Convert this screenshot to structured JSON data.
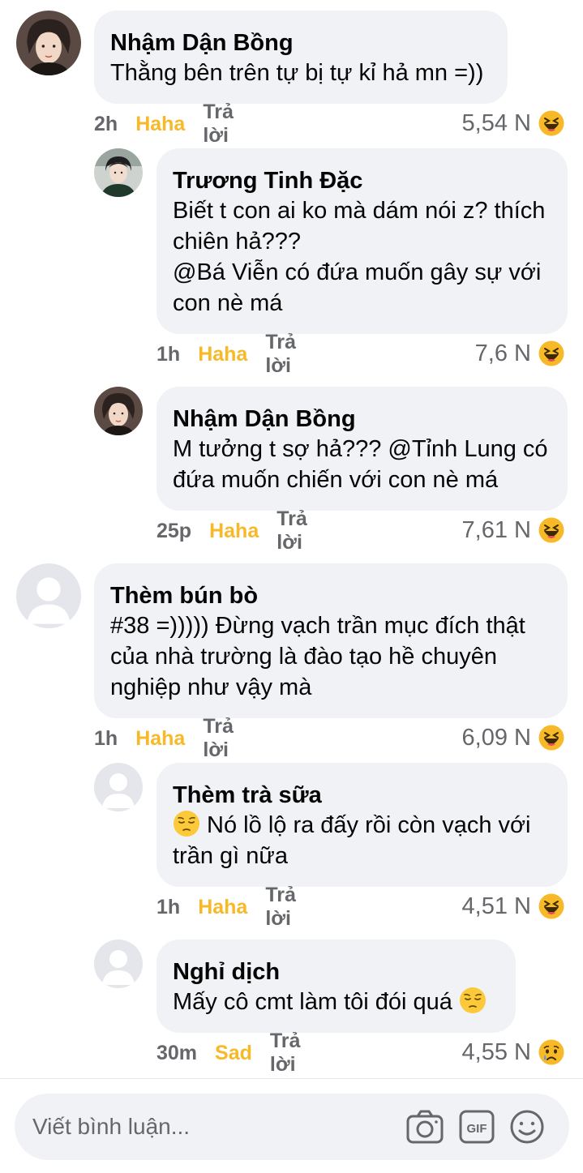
{
  "comments": [
    {
      "author": "Nhậm Dận Bồng",
      "text": "Thằng bên trên tự bị tự kỉ hả mn =))",
      "time": "2h",
      "reaction": "Haha",
      "reply": "Trả lời",
      "count": "5,54 N"
    },
    {
      "author": "Trương Tinh Đặc",
      "text": "Biết t con ai ko mà dám nói z? thích\nchiên hả???\n@Bá Viễn có đứa muốn gây sự với\ncon nè má",
      "time": "1h",
      "reaction": "Haha",
      "reply": "Trả lời",
      "count": "7,6 N"
    },
    {
      "author": "Nhậm Dận Bồng",
      "text": "M tưởng t sợ hả??? @Tỉnh Lung có\nđứa muốn chiến với con nè má",
      "time": "25p",
      "reaction": "Haha",
      "reply": "Trả lời",
      "count": "7,61 N"
    },
    {
      "author": "Thèm bún bò",
      "text": "#38 =))))) Đừng vạch trần mục đích thật\ncủa nhà trường là đào tạo hề chuyên\nnghiệp như vậy mà",
      "time": "1h",
      "reaction": "Haha",
      "reply": "Trả lời",
      "count": "6,09 N"
    },
    {
      "author": "Thèm trà sữa",
      "text": " Nó lồ lộ ra đấy rồi còn vạch với\ntrần gì nữa",
      "time": "1h",
      "reaction": "Haha",
      "reply": "Trả lời",
      "count": "4,51 N"
    },
    {
      "author": "Nghỉ dịch",
      "text": "Mấy cô cmt làm tôi đói quá ",
      "time": "30m",
      "reaction": "Sad",
      "reply": "Trả lời",
      "count": "4,55 N"
    }
  ],
  "composer": {
    "placeholder": "Viết bình luận..."
  },
  "icons": {
    "haha": "haha-emoji",
    "sad": "sad-emoji",
    "pensive": "pensive-emoji",
    "camera": "camera-icon",
    "gif": "gif-icon",
    "sticker": "smiley-icon"
  },
  "colors": {
    "bubble": "#f0f2f5",
    "haha_label": "#f7b928",
    "meta_gray": "#65676b"
  }
}
